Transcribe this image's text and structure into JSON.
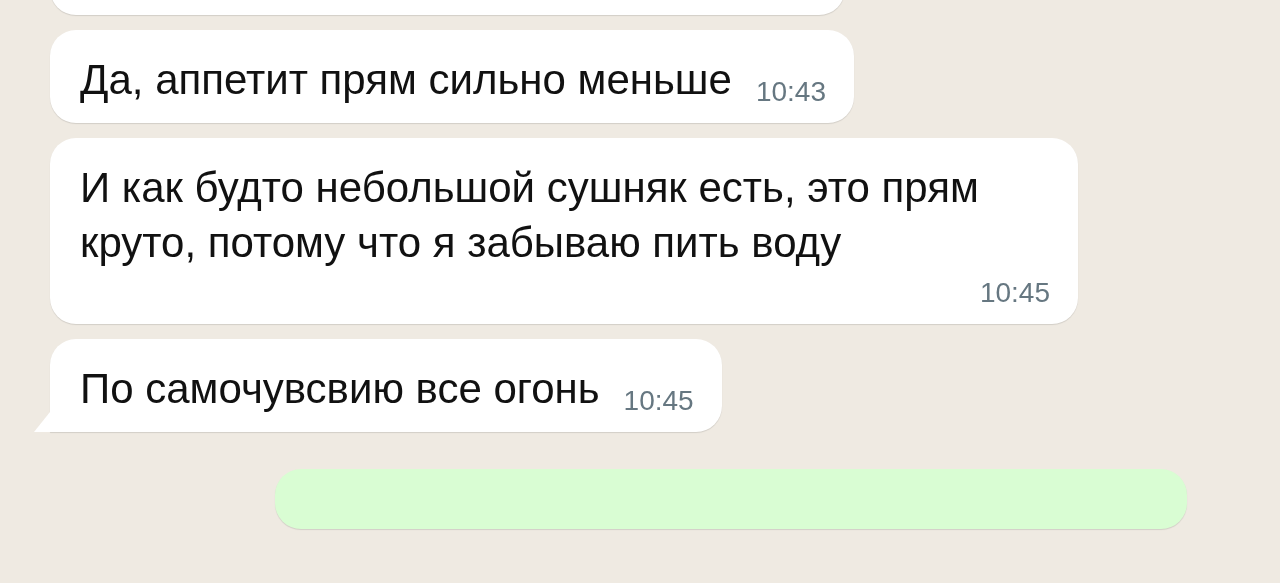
{
  "messages": [
    {
      "kind": "incoming",
      "tail": false
    },
    {
      "kind": "incoming",
      "text": "Да, аппетит прям сильно меньше",
      "time": "10:43",
      "tail": false
    },
    {
      "kind": "incoming",
      "text": "И как будто небольшой сушняк есть, это прям круто, потому что я забываю пить воду",
      "time": "10:45",
      "tail": false
    },
    {
      "kind": "incoming",
      "text": "По самочувсвию все огонь",
      "time": "10:45",
      "tail": true
    },
    {
      "kind": "outgoing",
      "tail": false
    }
  ]
}
